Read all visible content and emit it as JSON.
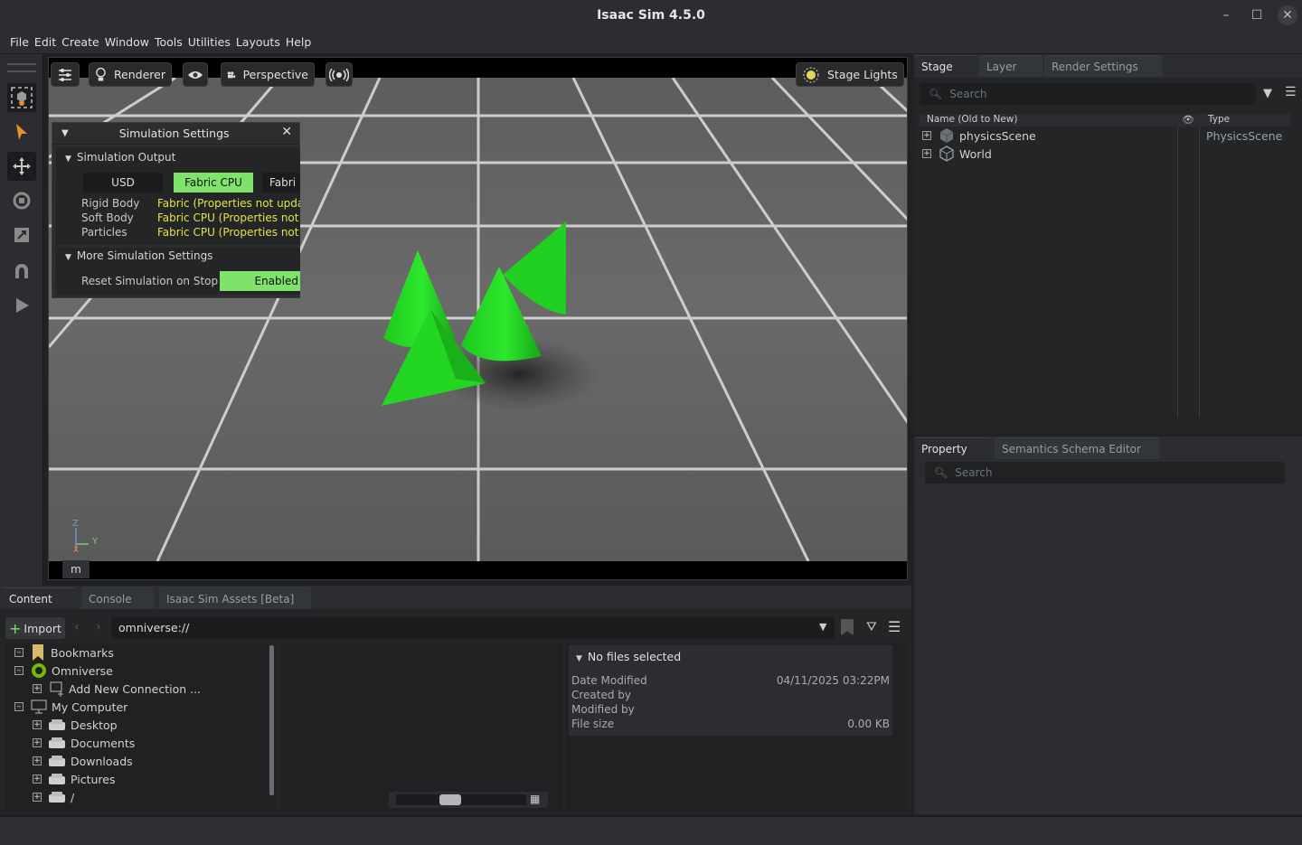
{
  "window": {
    "title": "Isaac Sim 4.5.0"
  },
  "menu": [
    "File",
    "Edit",
    "Create",
    "Window",
    "Tools",
    "Utilities",
    "Layouts",
    "Help"
  ],
  "viewport": {
    "renderer_label": "Renderer",
    "camera_label": "Perspective",
    "lights_label": "Stage Lights",
    "axis_z": "Z",
    "axis_y": "Y",
    "axis_x": "X",
    "units": "m"
  },
  "sim_settings": {
    "title": "Simulation Settings",
    "output_section": "Simulation Output",
    "output_options": [
      "USD",
      "Fabric CPU",
      "Fabri"
    ],
    "output_selected": "Fabric CPU",
    "rows": [
      {
        "label": "Rigid Body",
        "value_prefix": "Fabric",
        "value_suffix": " (Properties not upda"
      },
      {
        "label": "Soft Body",
        "value_prefix": "Fabric CPU",
        "value_suffix": " (Properties not u"
      },
      {
        "label": "Particles",
        "value_prefix": "Fabric CPU",
        "value_suffix": " (Properties not u"
      }
    ],
    "more_section": "More Simulation Settings",
    "reset_label": "Reset Simulation on Stop",
    "reset_value": "Enabled"
  },
  "stage": {
    "tabs": [
      "Stage",
      "Layer",
      "Render Settings"
    ],
    "search_placeholder": "Search",
    "col_name": "Name (Old to New)",
    "col_type": "Type",
    "items": [
      {
        "name": "physicsScene",
        "type": "PhysicsScene"
      },
      {
        "name": "World",
        "type": ""
      }
    ]
  },
  "property": {
    "tabs": [
      "Property",
      "Semantics Schema Editor"
    ],
    "search_placeholder": "Search"
  },
  "content": {
    "tabs": [
      "Content",
      "Console",
      "Isaac Sim Assets [Beta]"
    ],
    "import_label": "Import",
    "path": "omniverse://",
    "tree": {
      "bookmarks": "Bookmarks",
      "omniverse": "Omniverse",
      "add_connection": "Add New Connection ...",
      "my_computer": "My Computer",
      "desktop": "Desktop",
      "documents": "Documents",
      "downloads": "Downloads",
      "pictures": "Pictures",
      "root": "/"
    },
    "details": {
      "header": "No files selected",
      "date_modified_label": "Date Modified",
      "date_modified_value": "04/11/2025 03:22PM",
      "created_by_label": "Created by",
      "modified_by_label": "Modified by",
      "file_size_label": "File size",
      "file_size_value": "0.00 KB"
    }
  },
  "colors": {
    "accent_green": "#7ee26b",
    "cone_green": "#22dd22",
    "yellow_text": "#e4e34a"
  }
}
